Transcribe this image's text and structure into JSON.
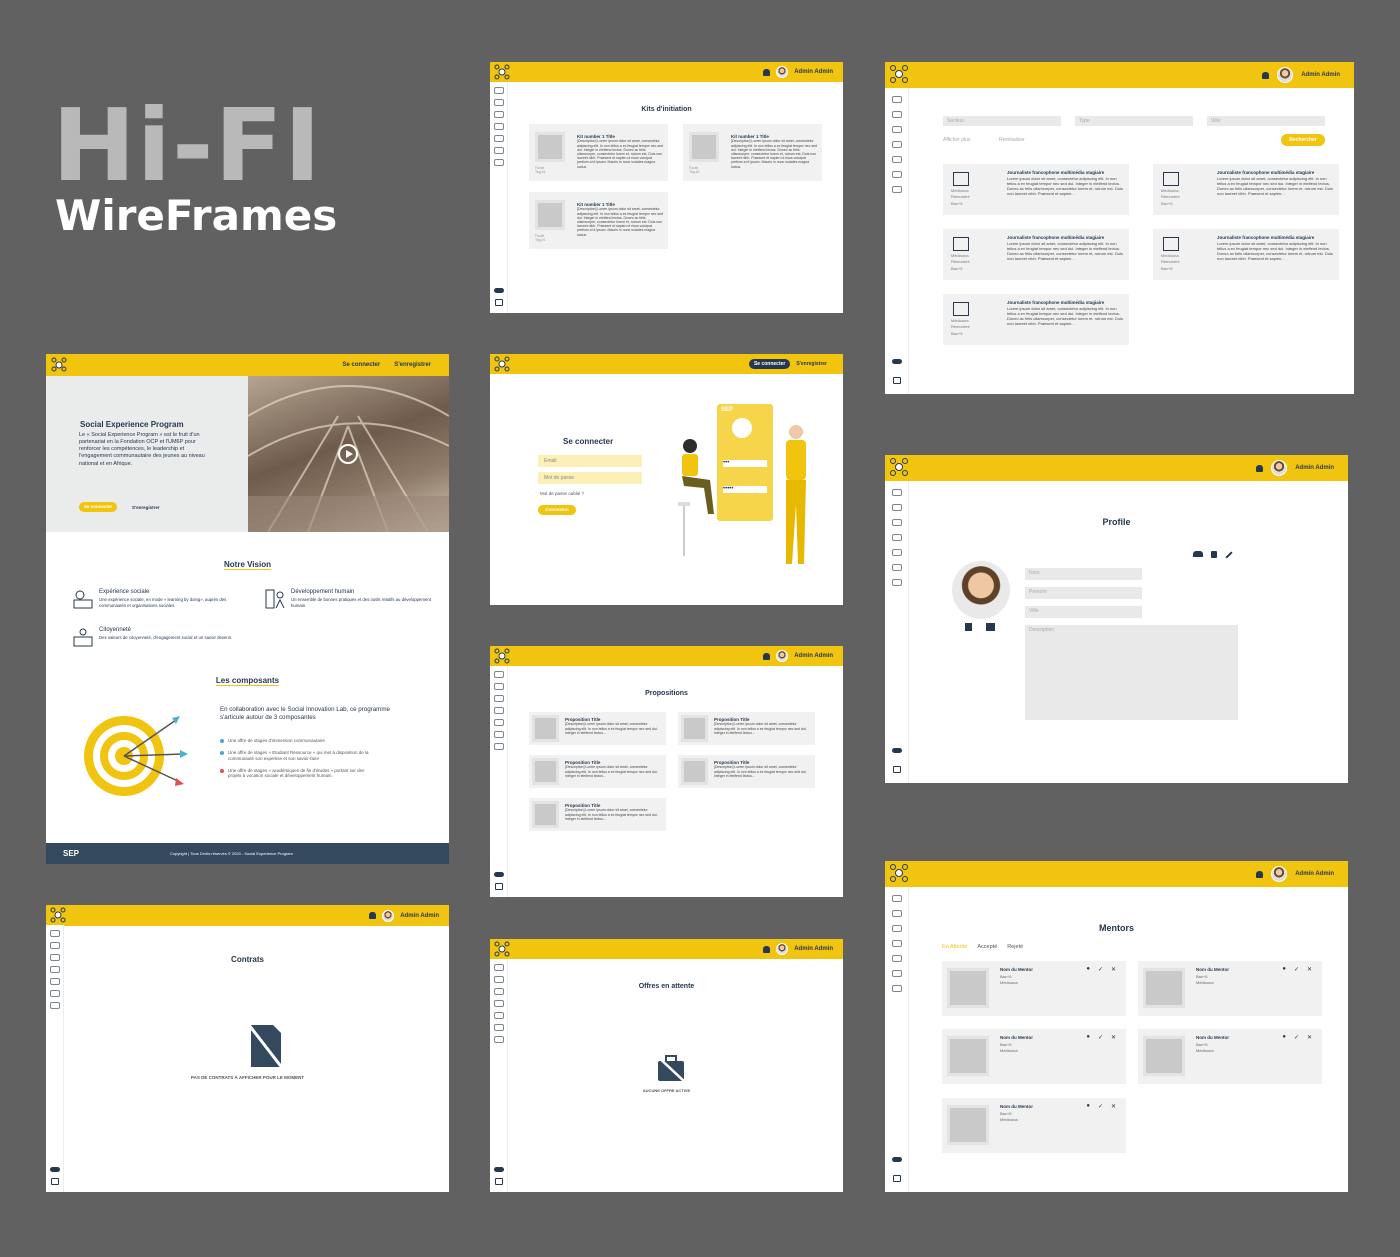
{
  "hero": {
    "line1": "Hi-FI",
    "line2": "WireFrames"
  },
  "admin_name": "Admin Admin",
  "landing": {
    "login": "Se connecter",
    "register": "S'enregistrer",
    "title": "Social Experience Program",
    "desc": "Le « Social Experience Program » est le fruit d'un partenariat en la Fondation OCP et l'UM6P pour renforcer les compétences, le leadership et l'engagement communautaire des jeunes au niveau national et en Afrique.",
    "btn_login": "Se connecter",
    "btn_register": "S'enregistrer",
    "vision_title": "Notre Vision",
    "vision": [
      {
        "title": "Expérience sociale",
        "desc": "Une expérience sociale, en mode « learning by doing», auprès des communautés et organisations sociales."
      },
      {
        "title": "Développement humain",
        "desc": "Un ensemble de bonnes pratiques et des outils relatifs au développement humain."
      },
      {
        "title": "Citoyenneté",
        "desc": "Des valeurs de citoyenneté, d'engagement social et un savoir devenir."
      }
    ],
    "comp_title": "Les composants",
    "comp_intro": "En collaboration avec le Social Innovation Lab, ce programme s'articule autour de 3 composantes",
    "comp_items": [
      "Une offre de stages d'immersion communautaire",
      "Une offre de stages « Etudiant Ressource » qui met à disposition de la communauté son expertise et son savoir-faire",
      "Une offre de stages « académiques de fin d'études » portant sur des projets à vocation sociale et développement humain."
    ],
    "footer_logo": "SEP",
    "footer_text": "Copyright | Tous Droits réservés © 2020 - Social Experience Program"
  },
  "kits": {
    "title": "Kits d'initiation",
    "card_title": "Kit number 1 Title",
    "desc": "[Description] Lorem ipsum dolor sit amet, consectetur adipiscing elit. In non tellus a ex feugiat tempor nec sed dui. Integer in eleifend lectus. Donec ac felis ullamcorper, consectetur lorem et, rutrum est. Duis non laoreet nibh. Praesent et sapien ut risus volutpat pretium a id ipsum. Mauris in nunc sodales magna luctus.",
    "tag1": "Facile",
    "tag2": "Tag #1"
  },
  "login": {
    "btn_login": "Se connecter",
    "btn_register": "S'enregistrer",
    "title": "Se connecter",
    "email": "Email",
    "password": "Mot de passe",
    "forgot": "Mot de passe oublié ?",
    "submit": "Connexion",
    "illus": "SEP"
  },
  "props": {
    "title": "Propositions",
    "card_title": "Proposition Title",
    "desc": "[Description] Lorem ipsum dolor sit amet, consectetur adipiscing elit. In non tellus a ex feugiat tempor nec sed dui. Integer in eleifend lectus..."
  },
  "contracts": {
    "title": "Contrats",
    "empty": "PAS DE CONTRATS À AFFICHER POUR LE MOMENT"
  },
  "pending": {
    "title": "Offres en attente",
    "empty": "AUCUNE OFFRE ACTIVE"
  },
  "offers": {
    "sector": "Secteur",
    "type": "Type",
    "city": "Ville",
    "more": "Afficher plus",
    "reset": "Reinitialiser",
    "search": "Rechercher",
    "card_title": "Journaliste francophone multimédia stagiaire",
    "desc": "Lorem ipsum dolor sit amet, consectetur adipiscing elit. In non tellus a ex feugiat tempor nec sed dui. Integer in eleifend lectus. Donec ac felis ullamcorper, consectetur lorem et, rutrum est. Duis non laoreet nibh. Praesent et sapien...",
    "loc": "Médiouna",
    "pay": "Rémunéré",
    "level": "Bac+5"
  },
  "profile": {
    "title": "Profile",
    "nom": "Nom",
    "prenom": "Prenom",
    "ville": "Ville",
    "desc": "Description"
  },
  "mentors": {
    "title": "Mentors",
    "tabs": [
      "En Attente",
      "Accepté",
      "Rejeté"
    ],
    "name": "Nom du Mentor",
    "level": "Bac+5",
    "city": "Médiouna"
  },
  "colors": {
    "accent": "#f1c40f",
    "navy": "#26384f",
    "bg": "#616161"
  }
}
